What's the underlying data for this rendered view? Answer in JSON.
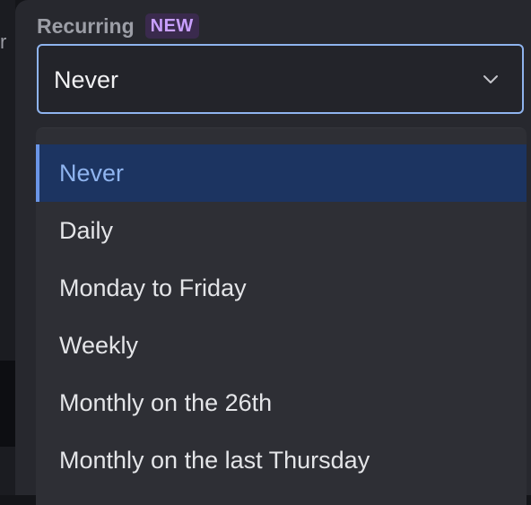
{
  "background": {
    "partial_label": "r"
  },
  "recurring": {
    "label": "Recurring",
    "badge": "NEW",
    "selected_value": "Never",
    "options": [
      "Never",
      "Daily",
      "Monday to Friday",
      "Weekly",
      "Monthly on the 26th",
      "Monthly on the last Thursday"
    ]
  },
  "colors": {
    "accent": "#8fb4ef",
    "badge_text": "#c9a0ff",
    "selected_bg": "#1c3461"
  }
}
